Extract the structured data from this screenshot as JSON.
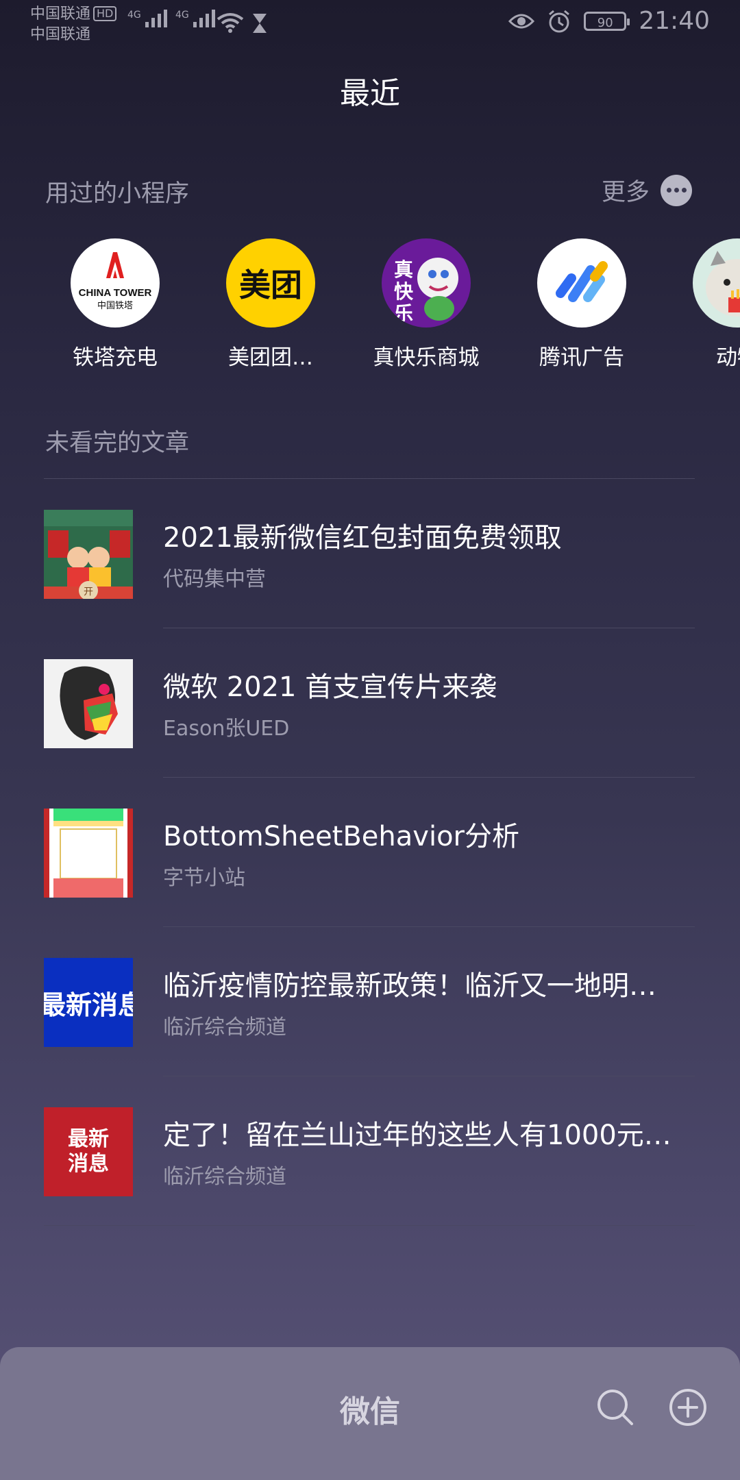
{
  "status_bar": {
    "carrier_1": "中国联通",
    "hd": "HD",
    "carrier_2": "中国联通",
    "signal_tag": "4G",
    "battery": "90",
    "time": "21:40"
  },
  "header": {
    "title": "最近"
  },
  "mini_programs": {
    "section_title": "用过的小程序",
    "more_label": "更多",
    "items": [
      {
        "label": "铁塔充电",
        "icon": "china-tower-logo",
        "logo_text_1": "CHINA TOWER",
        "logo_text_2": "中国铁塔"
      },
      {
        "label": "美团团…",
        "icon": "meituan-logo",
        "logo_text": "美团"
      },
      {
        "label": "真快乐商城",
        "icon": "zhenkuaile-logo",
        "logo_text": "真快乐"
      },
      {
        "label": "腾讯广告",
        "icon": "tencent-ads-logo"
      },
      {
        "label": "动物",
        "icon": "animal-game-logo"
      }
    ]
  },
  "articles": {
    "section_title": "未看完的文章",
    "items": [
      {
        "title": "2021最新微信红包封面免费领取",
        "source": "代码集中营",
        "thumb": "red-envelope-cover-thumb",
        "thumb_text": "开"
      },
      {
        "title": "微软 2021 首支宣传片来袭",
        "source": "Eason张UED",
        "thumb": "colorful-face-art-thumb"
      },
      {
        "title": "BottomSheetBehavior分析",
        "source": "字节小站",
        "thumb": "phone-screen-thumb"
      },
      {
        "title": "临沂疫情防控最新政策！临沂又一地明…",
        "source": "临沂综合频道",
        "thumb": "news-blue-thumb",
        "thumb_text": "最新消息"
      },
      {
        "title": "定了！留在兰山过年的这些人有1000元…",
        "source": "临沂综合频道",
        "thumb": "news-red-thumb",
        "thumb_text_1": "最新",
        "thumb_text_2": "消息"
      }
    ]
  },
  "bottom_bar": {
    "title": "微信"
  },
  "colors": {
    "background_top": "#1d1b2d",
    "background_bottom": "#5a5478",
    "bottom_bar": "#79758f",
    "meituan_yellow": "#ffd100",
    "zhenkuaile_purple": "#6a1b9a",
    "news_blue": "#0a2fc0",
    "news_red": "#c0202a"
  }
}
